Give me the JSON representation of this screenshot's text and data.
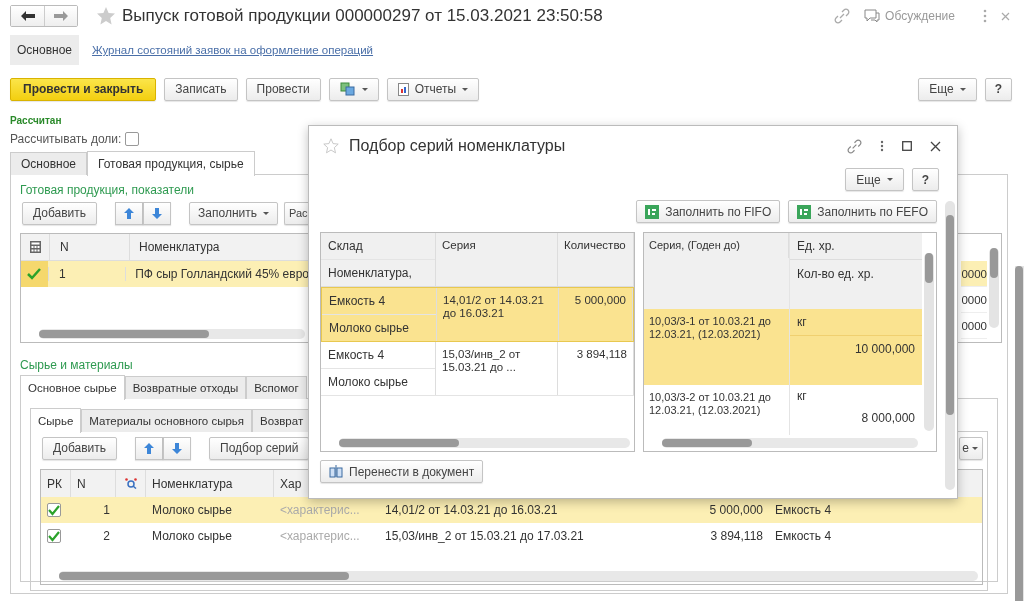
{
  "window": {
    "title": "Выпуск готовой продукции 000000297 от 15.03.2021 23:50:58",
    "discussion": "Обсуждение"
  },
  "nav": {
    "main": "Основное",
    "link": "Журнал состояний заявок на оформление операций"
  },
  "toolbar": {
    "buttons": [
      {
        "kind": "primary",
        "label": "Провести и закрыть"
      },
      {
        "kind": "plain",
        "label": "Записать"
      },
      {
        "kind": "plain",
        "label": "Провести"
      },
      {
        "kind": "icon-menu"
      },
      {
        "kind": "report-menu",
        "label": "Отчеты"
      }
    ],
    "more": "Еще",
    "help": "?"
  },
  "status": "Рассчитан",
  "calc_shares": {
    "label": "Рассчитывать доли:",
    "checked": false
  },
  "tabs": [
    {
      "label": "Основное",
      "selected": false
    },
    {
      "label": "Готовая продукция, сырье",
      "selected": true
    }
  ],
  "products": {
    "title": "Готовая продукция, показатели",
    "add": "Добавить",
    "fill": "Заполнить",
    "cut_button": "Рас",
    "columns": [
      "N",
      "Номенклатура"
    ],
    "rows": [
      {
        "n": "1",
        "name": "ПФ сыр Голландский 45% евро",
        "checked": true,
        "selected": true
      }
    ],
    "right_values": [
      {
        "value": "0000",
        "selected": true
      },
      {
        "value": "0000",
        "selected": false
      },
      {
        "value": "0000",
        "selected": false
      }
    ]
  },
  "materials": {
    "title": "Сырье и материалы",
    "tabs": [
      {
        "label": "Основное сырье",
        "selected": true
      },
      {
        "label": "Возвратные отходы",
        "selected": false
      },
      {
        "label": "Вспомог",
        "selected": false
      }
    ],
    "subtabs": [
      {
        "label": "Сырье",
        "selected": true
      },
      {
        "label": "Материалы основного сырья",
        "selected": false
      },
      {
        "label": "Возврат",
        "selected": false
      }
    ],
    "add": "Добавить",
    "pick": "Подбор серий",
    "cut_button": "е",
    "columns": [
      "РК",
      "N",
      "Номенклатура",
      "Хар"
    ],
    "rows": [
      {
        "checked": true,
        "n": "1",
        "name": "Молоко сырье",
        "characteristic": "<характерис...",
        "series": "14,01/2 от 14.03.21 до 16.03.21",
        "quantity": "5 000,000",
        "warehouse": "Емкость 4",
        "selected": true
      },
      {
        "checked": true,
        "n": "2",
        "name": "Молоко сырье",
        "characteristic": "<характерис...",
        "series": "15,03/инв_2 от 15.03.21 до 17.03.21",
        "quantity": "3 894,118",
        "warehouse": "Емкость 4",
        "selected": false
      }
    ]
  },
  "dialog": {
    "title": "Подбор серий номенклатуры",
    "more": "Еще",
    "help": "?",
    "fill_buttons": [
      "Заполнить по FIFO",
      "Заполнить по FEFO"
    ],
    "left_table": {
      "columns": [
        "Склад",
        "Номенклатура,",
        "Серия",
        "Количество"
      ],
      "rows": [
        {
          "warehouse": "Емкость 4",
          "item": "Молоко сырье",
          "series": "14,01/2 от 14.03.21 до 16.03.21",
          "quantity": "5 000,000",
          "selected": true
        },
        {
          "warehouse": "Емкость 4",
          "item": "Молоко сырье",
          "series": "15,03/инв_2 от 15.03.21 до ...",
          "quantity": "3 894,118",
          "selected": false
        }
      ]
    },
    "right_table": {
      "columns": [
        "Серия, (Годен до)",
        "Ед. хр.",
        "Кол-во ед. хр."
      ],
      "rows": [
        {
          "series": "10,03/3-1 от 10.03.21 до 12.03.21,  (12.03.2021)",
          "unit": "кг",
          "amount": "10 000,000",
          "selected": true
        },
        {
          "series": "10,03/3-2 от 10.03.21 до 12.03.21,  (12.03.2021)",
          "unit": "кг",
          "amount": "8 000,000",
          "selected": false
        }
      ]
    },
    "transfer": "Перенести в документ"
  }
}
